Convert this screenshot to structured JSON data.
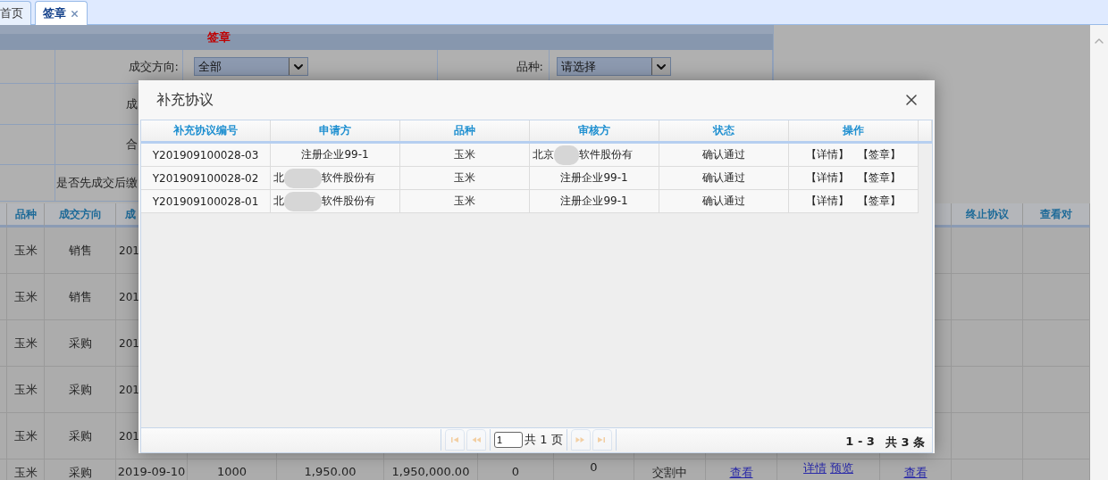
{
  "tabs": [
    {
      "label": "首页",
      "selected": false,
      "closable": false
    },
    {
      "label": "签章",
      "selected": true,
      "closable": true
    }
  ],
  "form": {
    "title": "签章",
    "rows": [
      {
        "label": "成交方向:",
        "select": "全部",
        "label_2": "品种:",
        "select_2": "请选择"
      },
      {
        "label": "成"
      },
      {
        "label": "合"
      },
      {
        "label": "是否先成交后缴"
      }
    ]
  },
  "grid": {
    "columns": [
      {
        "kind": "blank"
      },
      {
        "kind": "titled",
        "header": "品种"
      },
      {
        "kind": "titled",
        "header": "成交方向"
      },
      {
        "kind": "clipped",
        "header": "成"
      },
      {
        "kind": "blank"
      },
      {
        "kind": "blank"
      },
      {
        "kind": "blank"
      },
      {
        "kind": "blank"
      },
      {
        "kind": "blank"
      },
      {
        "kind": "blank"
      },
      {
        "kind": "blank"
      },
      {
        "kind": "blank"
      },
      {
        "kind": "blank"
      },
      {
        "kind": "titled",
        "header": "终止协议"
      },
      {
        "kind": "titled",
        "header": "查看对"
      }
    ],
    "rows": [
      {
        "cells": [
          {
            "kind": "blank"
          },
          {
            "kind": "text",
            "text": "玉米"
          },
          {
            "kind": "text",
            "text": "销售"
          },
          {
            "kind": "clipped",
            "text": "201"
          }
        ]
      },
      {
        "cells": [
          {
            "kind": "blank"
          },
          {
            "kind": "text",
            "text": "玉米"
          },
          {
            "kind": "text",
            "text": "销售"
          },
          {
            "kind": "clipped",
            "text": "201"
          }
        ]
      },
      {
        "cells": [
          {
            "kind": "blank"
          },
          {
            "kind": "text",
            "text": "玉米"
          },
          {
            "kind": "text",
            "text": "采购"
          },
          {
            "kind": "clipped",
            "text": "201"
          }
        ]
      },
      {
        "cells": [
          {
            "kind": "blank"
          },
          {
            "kind": "text",
            "text": "玉米"
          },
          {
            "kind": "text",
            "text": "采购"
          },
          {
            "kind": "clipped",
            "text": "201"
          }
        ]
      },
      {
        "cells": [
          {
            "kind": "blank"
          },
          {
            "kind": "text",
            "text": "玉米"
          },
          {
            "kind": "text",
            "text": "采购"
          },
          {
            "kind": "clipped",
            "text": "201"
          }
        ]
      },
      {
        "cells": [
          {
            "kind": "blank"
          },
          {
            "kind": "text",
            "text": "玉米"
          },
          {
            "kind": "text",
            "text": "采购"
          },
          {
            "kind": "text",
            "text": "2019-09-10"
          },
          {
            "kind": "text",
            "text": "1000"
          },
          {
            "kind": "text",
            "text": "1,950.00"
          },
          {
            "kind": "text",
            "text": "1,950,000.00"
          },
          {
            "kind": "text",
            "text": "0"
          },
          {
            "kind": "top",
            "text": "0"
          },
          {
            "kind": "text",
            "text": "交割中"
          },
          {
            "kind": "link",
            "text": "查看"
          },
          {
            "kind": "top_links",
            "links": [
              "详情",
              "预览"
            ]
          },
          {
            "kind": "link",
            "text": "查看"
          },
          {
            "kind": "blank"
          },
          {
            "kind": "blank"
          }
        ]
      }
    ]
  },
  "dialog": {
    "title": "补充协议",
    "columns": [
      "补充协议编号",
      "申请方",
      "品种",
      "审核方",
      "状态",
      "操作"
    ],
    "rows": [
      {
        "number": "Y201909100028-03",
        "applicant": {
          "text": "注册企业99-1",
          "redacted": false
        },
        "variety": "玉米",
        "reviewer": {
          "text": "北京",
          "redacted": true,
          "after": "软件股份有"
        },
        "status": "确认通过",
        "actions": [
          "【详情】",
          "【签章】"
        ]
      },
      {
        "number": "Y201909100028-02",
        "applicant": {
          "text": "北",
          "redacted": true,
          "after": "软件股份有"
        },
        "variety": "玉米",
        "reviewer": {
          "text": "注册企业99-1",
          "redacted": false
        },
        "status": "确认通过",
        "actions": [
          "【详情】",
          "【签章】"
        ]
      },
      {
        "number": "Y201909100028-01",
        "applicant": {
          "text": "北",
          "redacted": true,
          "after": "软件股份有"
        },
        "variety": "玉米",
        "reviewer": {
          "text": "注册企业99-1",
          "redacted": false
        },
        "status": "确认通过",
        "actions": [
          "【详情】",
          "【签章】"
        ]
      }
    ],
    "pager": {
      "buttons": [
        {
          "kind": "first",
          "disabled": true
        },
        {
          "kind": "prev",
          "disabled": true
        },
        {
          "kind": "next",
          "disabled": true
        },
        {
          "kind": "last",
          "disabled": true
        }
      ],
      "page": "1",
      "total_pages": "共 1 页",
      "range": "1 - 3",
      "total": "共 3 条"
    }
  }
}
